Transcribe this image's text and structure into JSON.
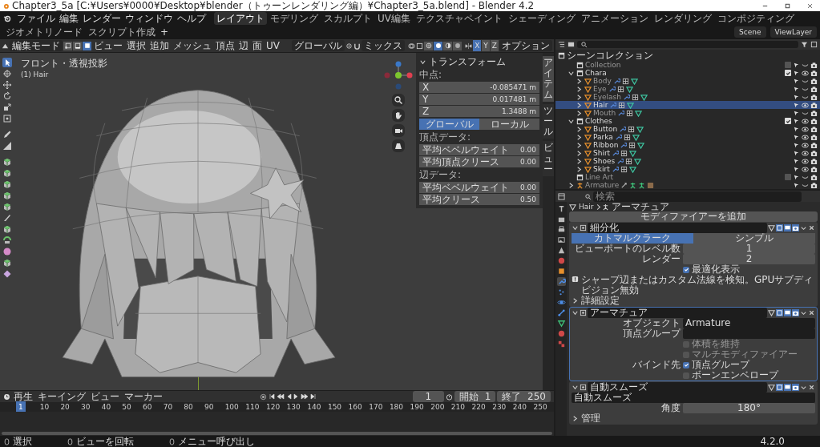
{
  "title_bar": {
    "title": "Chapter3_5a [C:¥Users¥0000¥Desktop¥blender（トゥーンレンダリング編）¥Chapter3_5a.blend] - Blender 4.2"
  },
  "menu_bar": {
    "menus": [
      "ファイル",
      "編集",
      "レンダー",
      "ウィンドウ",
      "ヘルプ"
    ],
    "workspaces": [
      {
        "label": "レイアウト",
        "selected": true
      },
      {
        "label": "モデリング",
        "selected": false
      },
      {
        "label": "スカルプト",
        "selected": false
      },
      {
        "label": "UV編集",
        "selected": false
      },
      {
        "label": "テクスチャペイント",
        "selected": false
      },
      {
        "label": "シェーディング",
        "selected": false
      },
      {
        "label": "アニメーション",
        "selected": false
      },
      {
        "label": "レンダリング",
        "selected": false
      },
      {
        "label": "コンポジティング",
        "selected": false
      },
      {
        "label": "ジオメトリノード",
        "selected": false
      },
      {
        "label": "スクリプト作成",
        "selected": false
      }
    ],
    "add_workspace": "+",
    "scene": "Scene",
    "view_layer": "ViewLayer"
  },
  "viewport_header": {
    "mode": "編集モード",
    "select_modes": [
      {
        "kind": "vertex",
        "selected": false
      },
      {
        "kind": "edge",
        "selected": false
      },
      {
        "kind": "face",
        "selected": true
      }
    ],
    "menus": [
      "ビュー",
      "選択",
      "追加",
      "メッシュ",
      "頂点",
      "辺",
      "面",
      "UV"
    ],
    "orientation": "グローバル",
    "proportional": "ミックス",
    "shading_modes": [
      {
        "kind": "wireframe",
        "selected": false
      },
      {
        "kind": "solid",
        "selected": true
      },
      {
        "kind": "material",
        "selected": false
      },
      {
        "kind": "rendered",
        "selected": false
      }
    ],
    "mirror": [
      {
        "label": "X",
        "selected": true
      },
      {
        "label": "Y",
        "selected": false
      },
      {
        "label": "Z",
        "selected": false
      }
    ],
    "options": "オプション"
  },
  "viewport": {
    "view_name": "フロント・透視投影",
    "object_label": "(1) Hair"
  },
  "sidebar": {
    "tabs": [
      {
        "label": "アイテム",
        "selected": true
      },
      {
        "label": "ツール",
        "selected": false
      },
      {
        "label": "ビュー",
        "selected": false
      }
    ],
    "title": "トランスフォーム",
    "median_label": "中点:",
    "fields": [
      {
        "axis": "X",
        "value": "-0.085471 m"
      },
      {
        "axis": "Y",
        "value": "0.017481 m"
      },
      {
        "axis": "Z",
        "value": "1.3488 m"
      }
    ],
    "space": [
      {
        "label": "グローバル",
        "selected": true
      },
      {
        "label": "ローカル",
        "selected": false
      }
    ],
    "sections": [
      {
        "title": "頂点データ:",
        "rows": [
          {
            "label": "平均ベベルウェイト",
            "value": "0.00"
          },
          {
            "label": "平均頂点クリース",
            "value": "0.00"
          }
        ]
      },
      {
        "title": "辺データ:",
        "rows": [
          {
            "label": "平均ベベルウェイト",
            "value": "0.00"
          },
          {
            "label": "平均クリース",
            "value": "0.50"
          }
        ]
      }
    ]
  },
  "outliner": {
    "root": "シーンコレクション",
    "tree": [
      {
        "name": "Collection",
        "kind": "collection",
        "checked": false,
        "visible": false,
        "selected": false
      },
      {
        "name": "Chara",
        "kind": "collection",
        "checked": true,
        "visible": true,
        "selected": false,
        "expanded": true,
        "children": [
          {
            "name": "Body",
            "kind": "mesh",
            "visible": false,
            "selected": false,
            "expanded": false
          },
          {
            "name": "Eye",
            "kind": "mesh",
            "visible": false,
            "selected": false,
            "expanded": false
          },
          {
            "name": "Eyelash",
            "kind": "mesh",
            "visible": false,
            "selected": false,
            "expanded": false
          },
          {
            "name": "Hair",
            "kind": "mesh",
            "visible": true,
            "selected": true,
            "expanded": false
          },
          {
            "name": "Mouth",
            "kind": "mesh",
            "visible": false,
            "selected": false,
            "expanded": false
          }
        ]
      },
      {
        "name": "Clothes",
        "kind": "collection",
        "checked": true,
        "visible": true,
        "selected": false,
        "expanded": true,
        "children": [
          {
            "name": "Button",
            "kind": "mesh",
            "visible": true,
            "selected": false,
            "expanded": false
          },
          {
            "name": "Parka",
            "kind": "mesh",
            "visible": true,
            "selected": false,
            "expanded": false
          },
          {
            "name": "Ribbon",
            "kind": "mesh",
            "visible": true,
            "selected": false,
            "expanded": false
          },
          {
            "name": "Shirt",
            "kind": "mesh",
            "visible": true,
            "selected": false,
            "expanded": false
          },
          {
            "name": "Shoes",
            "kind": "mesh",
            "visible": true,
            "selected": false,
            "expanded": false
          },
          {
            "name": "Skirt",
            "kind": "mesh",
            "visible": true,
            "selected": false,
            "expanded": false
          }
        ]
      },
      {
        "name": "Line Art",
        "kind": "collection",
        "checked": false,
        "visible": false,
        "selected": false
      },
      {
        "name": "Armature",
        "kind": "armature",
        "visible": false,
        "selected": false,
        "expanded": false
      }
    ]
  },
  "properties": {
    "search_placeholder": "検索",
    "breadcrumb": [
      "Hair",
      "アーマチュア"
    ],
    "add_modifier": "モディファイアーを追加",
    "modifiers": [
      {
        "kind": "subdivision",
        "name": "細分化",
        "algorithms": [
          {
            "label": "カトマルクラーク",
            "selected": true
          },
          {
            "label": "シンプル",
            "selected": false
          }
        ],
        "rows": [
          {
            "label": "ビューポートのレベル数",
            "value": "1"
          },
          {
            "label": "レンダー",
            "value": "2"
          }
        ],
        "optimal_display": {
          "label": "最適化表示",
          "checked": true
        },
        "notice": "シャープ辺またはカスタム法線を検知。GPUサブディビジョン無効",
        "subpanel": "詳細設定"
      },
      {
        "kind": "armature",
        "name": "アーマチュア",
        "object_label": "オブジェクト",
        "object": "Armature",
        "vertex_group_label": "頂点グループ",
        "options": [
          {
            "label": "体積を維持",
            "checked": false
          },
          {
            "label": "マルチモディファイアー",
            "checked": false
          }
        ],
        "bind_label": "バインド先",
        "bind": [
          {
            "label": "頂点グループ",
            "checked": true
          },
          {
            "label": "ボーンエンベロープ",
            "checked": false
          }
        ]
      },
      {
        "kind": "geometry_nodes",
        "name": "自動スムーズ",
        "node_group": "自動スムーズ",
        "angle_label": "角度",
        "angle": "180°",
        "subpanel": "管理"
      }
    ]
  },
  "timeline": {
    "menus": [
      "再生",
      "キーイング",
      "ビュー",
      "マーカー"
    ],
    "current_frame": "1",
    "start_label": "開始",
    "start": "1",
    "end_label": "終了",
    "end": "250",
    "ticks": [
      {
        "label": "1",
        "selected": true
      },
      {
        "label": "10",
        "selected": false
      },
      {
        "label": "20",
        "selected": false
      },
      {
        "label": "30",
        "selected": false
      },
      {
        "label": "40",
        "selected": false
      },
      {
        "label": "50",
        "selected": false
      },
      {
        "label": "60",
        "selected": false
      },
      {
        "label": "70",
        "selected": false
      },
      {
        "label": "80",
        "selected": false
      },
      {
        "label": "90",
        "selected": false
      },
      {
        "label": "100",
        "selected": false
      },
      {
        "label": "110",
        "selected": false
      },
      {
        "label": "120",
        "selected": false
      },
      {
        "label": "130",
        "selected": false
      },
      {
        "label": "140",
        "selected": false
      },
      {
        "label": "150",
        "selected": false
      },
      {
        "label": "160",
        "selected": false
      },
      {
        "label": "170",
        "selected": false
      },
      {
        "label": "180",
        "selected": false
      },
      {
        "label": "190",
        "selected": false
      },
      {
        "label": "200",
        "selected": false
      },
      {
        "label": "210",
        "selected": false
      },
      {
        "label": "220",
        "selected": false
      },
      {
        "label": "230",
        "selected": false
      },
      {
        "label": "240",
        "selected": false
      },
      {
        "label": "250",
        "selected": false
      }
    ]
  },
  "status_bar": {
    "items": [
      "選択",
      "ビューを回転",
      "メニュー呼び出し"
    ],
    "version": "4.2.0"
  }
}
